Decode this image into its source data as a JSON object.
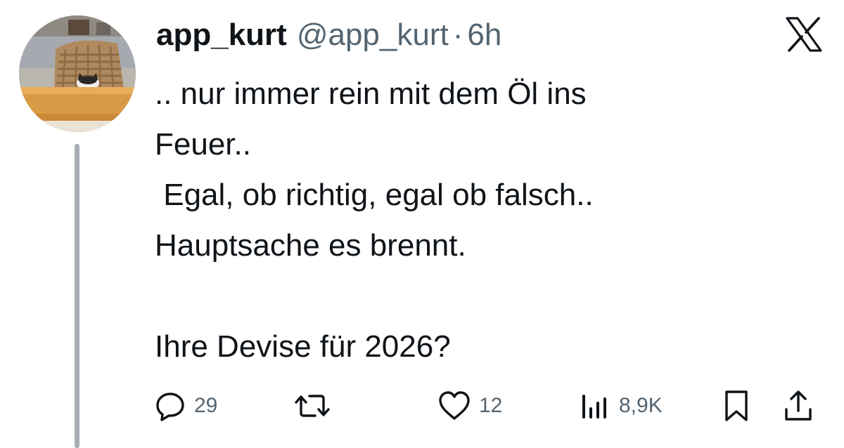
{
  "post": {
    "author": {
      "display_name": "app_kurt",
      "handle": "@app_kurt",
      "separator": "·",
      "time": "6h"
    },
    "text_lines": [
      ".. nur immer rein mit dem Öl ins",
      "Feuer..",
      " Egal, ob richtig, egal ob falsch..",
      "Hauptsache es brennt.",
      "",
      "Ihre Devise für 2026?"
    ],
    "actions": {
      "reply": {
        "icon": "reply-icon",
        "count": "29"
      },
      "repost": {
        "icon": "repost-icon",
        "count": ""
      },
      "like": {
        "icon": "heart-icon",
        "count": "12"
      },
      "views": {
        "icon": "views-icon",
        "count": "8,9K"
      },
      "bookmark": {
        "icon": "bookmark-icon"
      },
      "share": {
        "icon": "share-icon"
      }
    }
  },
  "brand": {
    "logo_icon": "x-logo-icon"
  },
  "colors": {
    "text_primary": "#0f1419",
    "text_secondary": "#536471",
    "thread_line": "#a7aeb5",
    "background": "#ffffff"
  }
}
